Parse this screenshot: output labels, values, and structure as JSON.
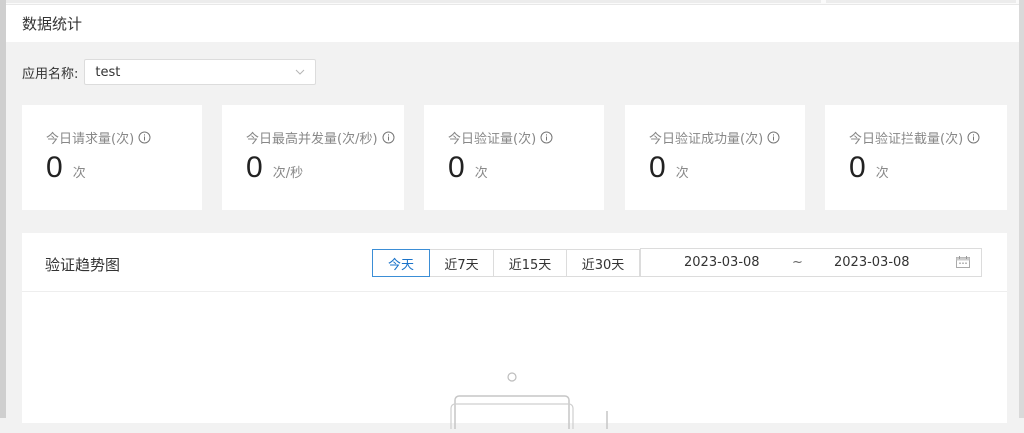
{
  "header": {
    "title": "数据统计"
  },
  "filter": {
    "label": "应用名称:",
    "selected": "test"
  },
  "stats": [
    {
      "title": "今日请求量(次)",
      "value": "0",
      "unit": "次"
    },
    {
      "title": "今日最高并发量(次/秒)",
      "value": "0",
      "unit": "次/秒"
    },
    {
      "title": "今日验证量(次)",
      "value": "0",
      "unit": "次"
    },
    {
      "title": "今日验证成功量(次)",
      "value": "0",
      "unit": "次"
    },
    {
      "title": "今日验证拦截量(次)",
      "value": "0",
      "unit": "次"
    }
  ],
  "trend": {
    "title": "验证趋势图",
    "tabs": [
      "今天",
      "近7天",
      "近15天",
      "近30天"
    ],
    "active_tab": "今天",
    "date_start": "2023-03-08",
    "date_separator": "~",
    "date_end": "2023-03-08"
  },
  "colors": {
    "accent": "#3b8ed6",
    "card_bg": "#ffffff",
    "page_bg": "#f2f2f2",
    "muted_text": "#888888"
  },
  "icons": {
    "info": "info-icon",
    "dropdown": "chevron-down-icon",
    "calendar": "calendar-icon",
    "empty": "empty-state-illustration"
  }
}
